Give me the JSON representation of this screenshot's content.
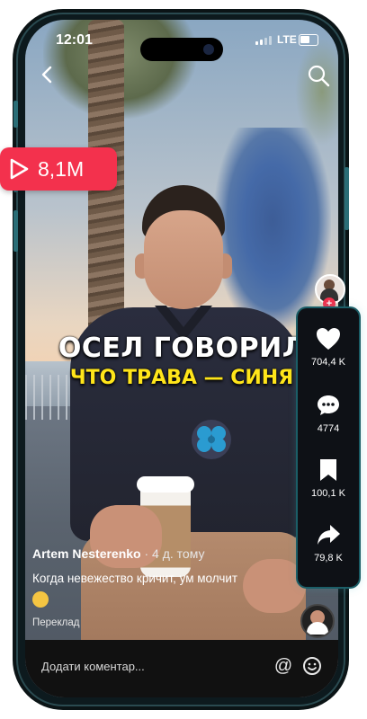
{
  "status": {
    "time": "12:01",
    "network": "LTE"
  },
  "views_badge": {
    "count": "8,1M",
    "icon": "play-icon"
  },
  "caption": {
    "line1": "ОСЕЛ ГОВОРИЛ",
    "line2": "ЧТО ТРАВА — СИНЯ"
  },
  "post": {
    "author": "Artem Nesterenko",
    "posted_ago": "· 4 д. тому",
    "description": "Когда невежество кричит, ум молчит",
    "translate_label": "Переклад"
  },
  "actions": {
    "likes": "704,4 K",
    "comments": "4774",
    "saves": "100,1 K",
    "shares": "79,8 K"
  },
  "comment_bar": {
    "placeholder": "Додати коментар..."
  },
  "colors": {
    "badge": "#f3314d",
    "caption_yellow": "#ffe51a",
    "panel_glow": "#1b5e67"
  }
}
